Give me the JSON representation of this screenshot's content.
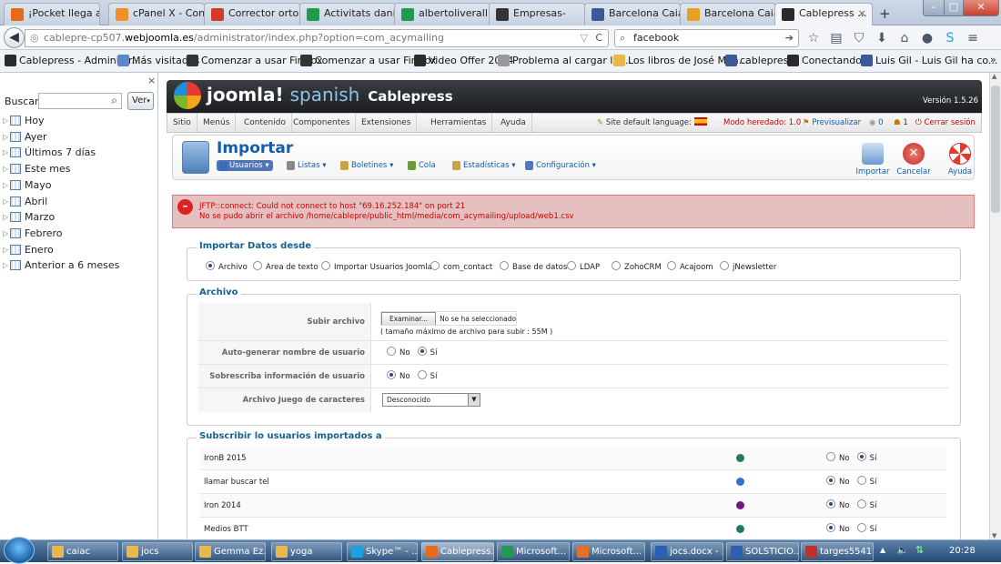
{
  "tabs": [
    {
      "label": "¡Pocket llega a ...",
      "icon": "firefox-icon",
      "color": "#e76a1b"
    },
    {
      "label": "cPanel X - Con...",
      "icon": "cpanel-icon",
      "color": "#f0902a"
    },
    {
      "label": "Corrector orto...",
      "icon": "corrector-icon",
      "color": "#d23a2a"
    },
    {
      "label": "Activitats dani ...",
      "icon": "sheets-icon",
      "color": "#1f9b4f"
    },
    {
      "label": "albertoliverall...",
      "icon": "sheets-icon",
      "color": "#1f9b4f"
    },
    {
      "label": "Empresas-",
      "icon": "s-icon",
      "color": "#333"
    },
    {
      "label": "Barcelona CaiaC",
      "icon": "facebook-icon",
      "color": "#3b5998"
    },
    {
      "label": "Barcelona Caia...",
      "icon": "barcelona-icon",
      "color": "#e8a020"
    },
    {
      "label": "Cablepress ...",
      "icon": "joomla-icon",
      "color": "#2a2a2a"
    }
  ],
  "address": {
    "prefix": "cablepre-cp507.",
    "domain": "webjoomla.es",
    "path": "/administrator/index.php?option=com_acymailing"
  },
  "search": {
    "value": "facebook"
  },
  "bookmarks": [
    {
      "label": "Cablepress - Administr...",
      "color": "#2a2a2a"
    },
    {
      "label": "Más visitados",
      "color": "#5a89c9"
    },
    {
      "label": "Comenzar a usar Firefox",
      "color": "#333"
    },
    {
      "label": "Comenzar a usar Firefox",
      "color": "#333"
    },
    {
      "label": "Video Offer 2014",
      "color": "#2a2a2a"
    },
    {
      "label": "Problema al cargar la ...",
      "color": "#999"
    },
    {
      "label": "Los libros de José Man...",
      "color": "#e8b84a"
    },
    {
      "label": "cablepress",
      "color": "#3b5998"
    },
    {
      "label": "Conectando...",
      "color": "#2a2a2a"
    },
    {
      "label": "Luis Gil - Luis Gil ha co...",
      "color": "#3b5998"
    }
  ],
  "sidebar": {
    "search_label": "Buscar:",
    "view_button": "Ver",
    "items": [
      "Hoy",
      "Ayer",
      "Últimos 7 días",
      "Este mes",
      "Mayo",
      "Abril",
      "Marzo",
      "Febrero",
      "Enero",
      "Anterior a 6 meses"
    ]
  },
  "joomla": {
    "logo": "joomla!",
    "logo_sub": "spanish",
    "site": "Cablepress",
    "version": "Versión 1.5.26",
    "menu": [
      "Sitio",
      "Menús",
      "Contenido",
      "Componentes",
      "Extensiones",
      "Herramientas",
      "Ayuda"
    ],
    "right": {
      "lang": "Site default language:",
      "legacy": "Modo heredado: 1.0",
      "preview": "Previsualizar",
      "msgs": "0",
      "users": "1",
      "logout": "Cerrar sesión"
    }
  },
  "toolbar": {
    "title": "Importar",
    "submenu": [
      "Usuarios ▾",
      "Listas ▾",
      "Boletines ▾",
      "Cola",
      "Estadísticas ▾",
      "Configuración ▾"
    ],
    "buttons": [
      "Importar",
      "Cancelar",
      "Ayuda"
    ]
  },
  "error": {
    "line1": "JFTP::connect: Could not connect to host \"69.16.252.184\" on port 21",
    "line2": "No se pudo abrir el archivo /home/cablepre/public_html/media/com_acymailing/upload/web1.csv"
  },
  "import_from": {
    "legend": "Importar Datos desde",
    "options": [
      "Archivo",
      "Area de texto",
      "Importar Usuarios Joomla",
      "com_contact",
      "Base de datos",
      "LDAP",
      "ZohoCRM",
      "Acajoom",
      "jNewsletter"
    ]
  },
  "file": {
    "legend": "Archivo",
    "upload_label": "Subir archivo",
    "browse": "Examinar...",
    "no_file": "No se ha seleccionado ning",
    "max_size": "( tamaño máximo de archivo para subir : 55M )",
    "autogen_label": "Auto-generar nombre de usuario",
    "overwrite_label": "Sobrescriba información de usuario existente",
    "charset_label": "Archivo Juego de caracteres",
    "charset_value": "Desconocido",
    "no": "No",
    "yes": "Sí"
  },
  "subscribe": {
    "legend": "Subscribir lo usuarios importados a",
    "lists": [
      {
        "name": "IronB 2015",
        "color": "#1f7a66",
        "selected": "Sí"
      },
      {
        "name": "llamar buscar tel",
        "color": "#2f6fd6",
        "selected": "No"
      },
      {
        "name": "Iron 2014",
        "color": "#6b1a7a",
        "selected": "No"
      },
      {
        "name": "Medios BTT",
        "color": "#1f7a66",
        "selected": "No"
      }
    ]
  },
  "taskbar": {
    "items": [
      {
        "label": "caiac",
        "color": "#e8b84a"
      },
      {
        "label": "jocs",
        "color": "#e8b84a"
      },
      {
        "label": "Gemma Ez...",
        "color": "#e8b84a"
      },
      {
        "label": "yoga",
        "color": "#e8b84a"
      },
      {
        "label": "Skype™ - ...",
        "color": "#1ea1e0"
      },
      {
        "label": "Cablepress...",
        "color": "#e76a1b"
      },
      {
        "label": "Microsoft...",
        "color": "#1f9b4f"
      },
      {
        "label": "Microsoft...",
        "color": "#e0702a"
      },
      {
        "label": "jocs.docx - ...",
        "color": "#2b5fb4"
      },
      {
        "label": "SOLSTICIO...",
        "color": "#2b5fb4"
      },
      {
        "label": "targes5541...",
        "color": "#c0302a"
      }
    ],
    "clock": "20:28"
  }
}
